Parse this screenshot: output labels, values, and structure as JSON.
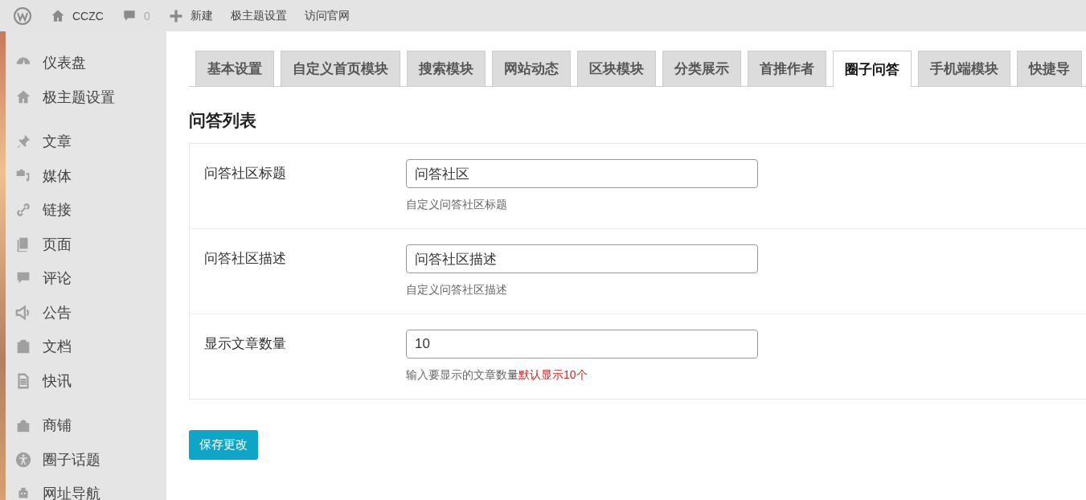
{
  "admin_bar": {
    "site_name": "CCZC",
    "comment_count": "0",
    "new_label": "新建",
    "links": [
      "极主题设置",
      "访问官网"
    ]
  },
  "sidebar": {
    "groups": [
      {
        "items": [
          {
            "label": "仪表盘"
          },
          {
            "label": "极主题设置"
          }
        ]
      },
      {
        "items": [
          {
            "label": "文章"
          },
          {
            "label": "媒体"
          },
          {
            "label": "链接"
          },
          {
            "label": "页面"
          },
          {
            "label": "评论"
          },
          {
            "label": "公告"
          },
          {
            "label": "文档"
          },
          {
            "label": "快讯"
          }
        ]
      },
      {
        "items": [
          {
            "label": "商铺"
          },
          {
            "label": "圈子话题"
          },
          {
            "label": "网址导航"
          }
        ]
      }
    ]
  },
  "tabs": [
    {
      "label": "基本设置",
      "selected": false
    },
    {
      "label": "自定义首页模块",
      "selected": false
    },
    {
      "label": "搜索模块",
      "selected": false
    },
    {
      "label": "网站动态",
      "selected": false
    },
    {
      "label": "区块模块",
      "selected": false
    },
    {
      "label": "分类展示",
      "selected": false
    },
    {
      "label": "首推作者",
      "selected": false
    },
    {
      "label": "圈子问答",
      "selected": true
    },
    {
      "label": "手机端模块",
      "selected": false
    },
    {
      "label": "快捷导",
      "selected": false
    }
  ],
  "section_title": "问答列表",
  "fields": [
    {
      "label": "问答社区标题",
      "value": "问答社区",
      "hint": "自定义问答社区标题"
    },
    {
      "label": "问答社区描述",
      "value": "问答社区描述",
      "hint": "自定义问答社区描述"
    },
    {
      "label": "显示文章数量",
      "value": "10",
      "hint": "输入要显示的文章数量",
      "hint_note": "默认显示10个"
    }
  ],
  "save_button": "保存更改"
}
